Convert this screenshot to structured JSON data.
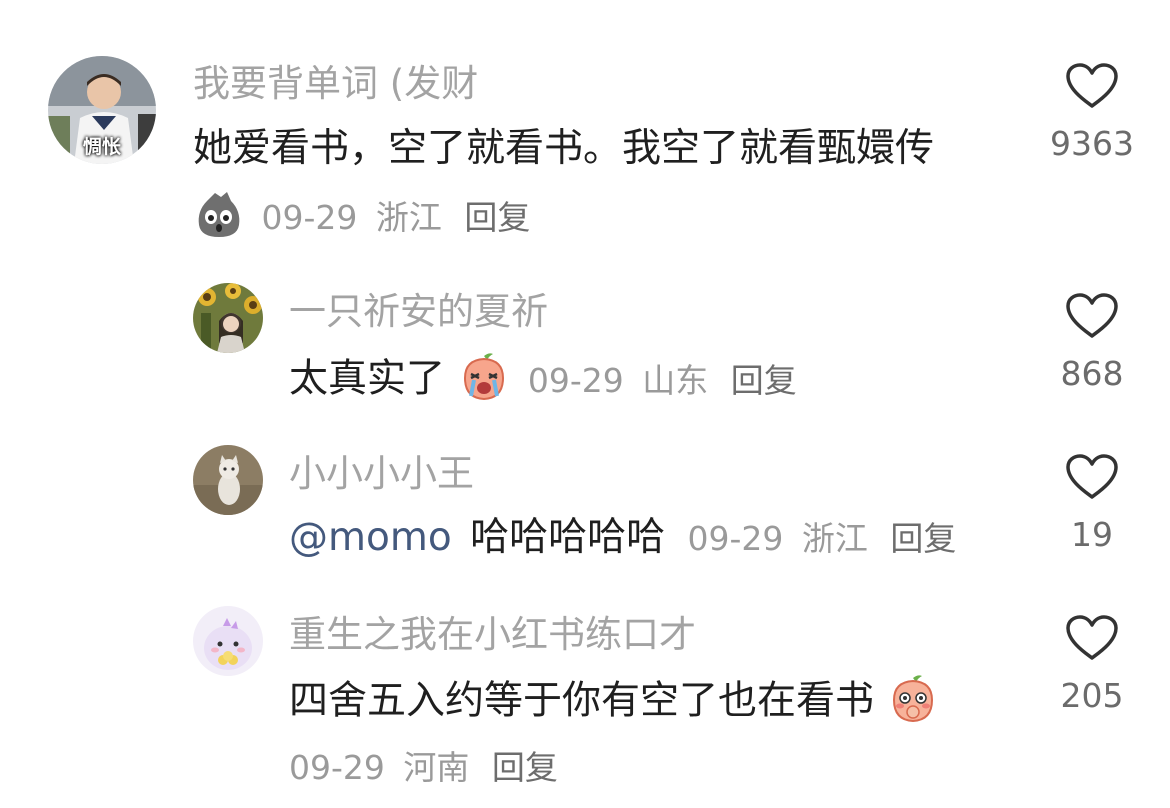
{
  "comments": [
    {
      "username": "我要背单词 (发财",
      "content": "她爱看书，空了就看书。我空了就看甄嬛传",
      "avatar_caption": "惆怅",
      "date": "09-29",
      "location": "浙江",
      "reply_label": "回复",
      "like_count": "9363",
      "emoji": "ghost-bag-emoji"
    },
    {
      "username": "一只祈安的夏祈",
      "content": "太真实了",
      "date": "09-29",
      "location": "山东",
      "reply_label": "回复",
      "like_count": "868",
      "emoji": "crying-peach-emoji"
    },
    {
      "username": "小小小小王",
      "mention": "@momo",
      "content": "哈哈哈哈哈",
      "date": "09-29",
      "location": "浙江",
      "reply_label": "回复",
      "like_count": "19"
    },
    {
      "username": "重生之我在小红书练口才",
      "content": "四舍五入约等于你有空了也在看书",
      "date": "09-29",
      "location": "河南",
      "reply_label": "回复",
      "like_count": "205",
      "emoji": "blushing-peach-emoji"
    }
  ],
  "colors": {
    "username": "#a3a3a3",
    "content": "#1f1f1f",
    "meta": "#9a9a9a",
    "mention": "#44597d",
    "heart_outline": "#333333"
  },
  "icons": {
    "like": "heart-outline-icon"
  }
}
